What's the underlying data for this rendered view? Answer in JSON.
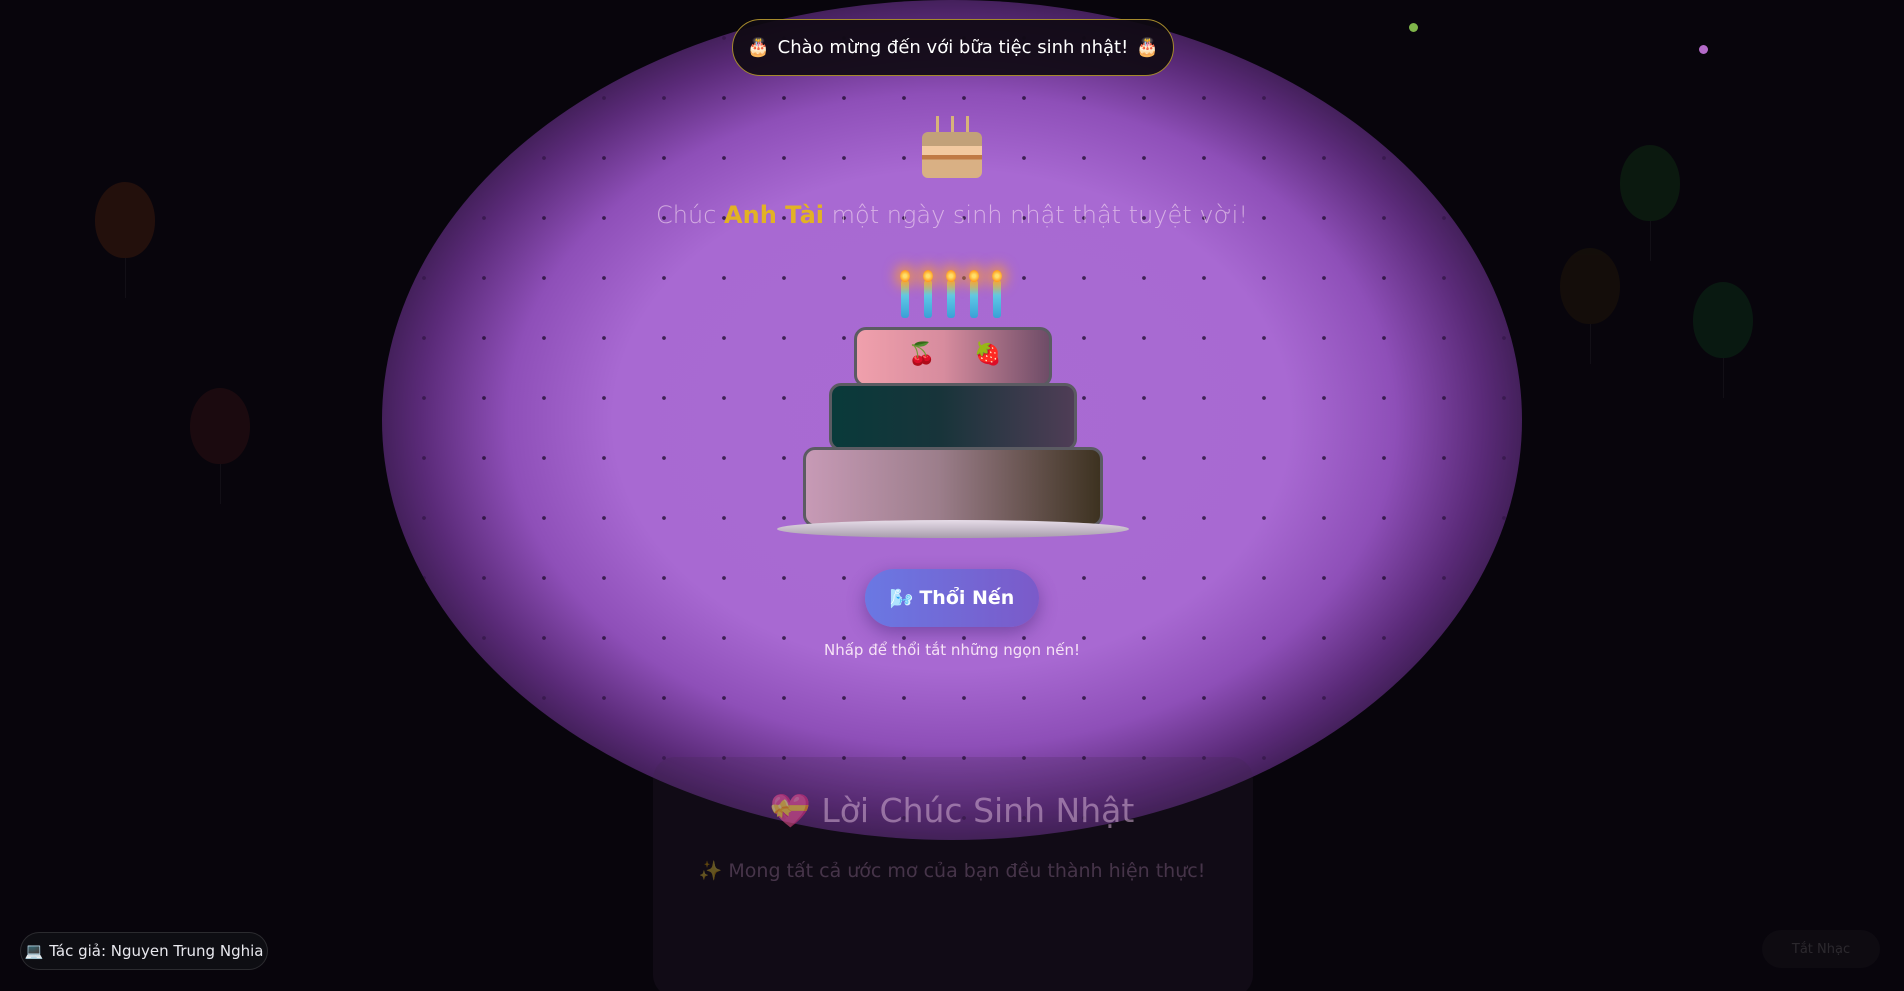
{
  "banner": {
    "icon_left": "🎂",
    "text": "Chào mừng đến với bữa tiệc sinh nhật!",
    "icon_right": "🎂"
  },
  "greeting": {
    "prefix": "Chúc",
    "name": "Anh Tài",
    "suffix": "một ngày sinh nhật thật tuyệt vời!"
  },
  "cake": {
    "candle_count": 5,
    "fruits": [
      "🍒",
      "🍓"
    ]
  },
  "blow_button": {
    "icon": "🌬️",
    "label": "Thổi Nến"
  },
  "hint": "Nhấp để thổi tắt những ngọn nến!",
  "wishes": {
    "icon": "💝",
    "title": "Lời Chúc Sinh Nhật",
    "first_wish_icon": "✨",
    "first_wish": "Mong tất cả ước mơ của bạn đều thành hiện thực!"
  },
  "author": {
    "icon": "💻",
    "label": "Tác giả: Nguyen Trung Nghia"
  },
  "music_button": {
    "label": "Tắt Nhạc"
  },
  "colors": {
    "spotlight": "#a96bd3",
    "name_highlight": "#e2b224",
    "banner_border": "#a58a2c",
    "button_start": "#6a78e3",
    "button_end": "#7b5ac9"
  }
}
